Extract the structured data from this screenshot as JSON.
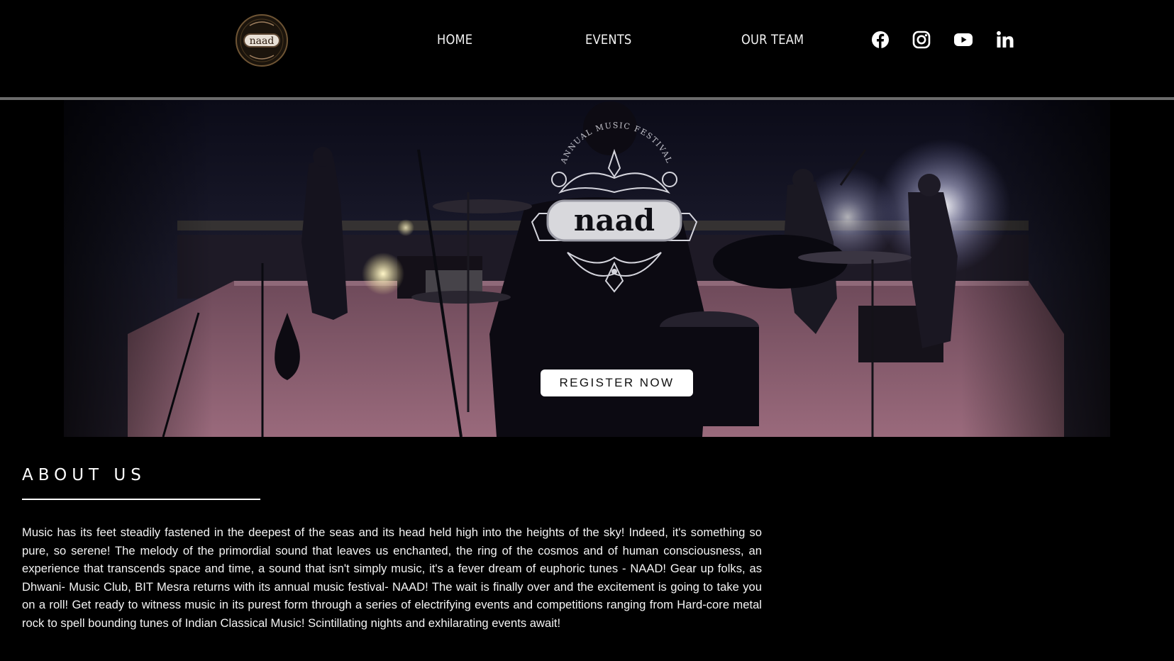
{
  "brand": {
    "logo_text": "naad",
    "festival_caption": "ANNUAL MUSIC FESTIVAL"
  },
  "nav": {
    "items": [
      {
        "label": "HOME"
      },
      {
        "label": "EVENTS"
      },
      {
        "label": "OUR TEAM"
      }
    ]
  },
  "social": [
    {
      "name": "facebook-icon"
    },
    {
      "name": "instagram-icon"
    },
    {
      "name": "youtube-icon"
    },
    {
      "name": "linkedin-icon"
    }
  ],
  "hero": {
    "register_label": "REGISTER NOW"
  },
  "about": {
    "title": "ABOUT US",
    "body": "Music has its feet steadily fastened in the deepest of the seas and its head held high into the heights of the sky! Indeed, it's something so pure, so serene! The melody of the primordial sound that leaves us enchanted, the ring of the cosmos and of human consciousness, an experience that transcends space and time, a sound that isn't simply music, it's a fever dream of euphoric tunes - NAAD! Gear up folks, as Dhwani- Music Club, BIT Mesra returns with its annual music festival- NAAD! The wait is finally over and the excitement is going to take you on a roll! Get ready to witness music in its purest form through a series of electrifying events and competitions ranging from Hard-core metal rock to spell bounding tunes of Indian Classical Music! Scintillating nights and exhilarating events await!"
  },
  "colors": {
    "background": "#000000",
    "header_line": "#6b6b6b",
    "stage_floor": "#8a5a6a",
    "button_bg": "#ffffff"
  }
}
